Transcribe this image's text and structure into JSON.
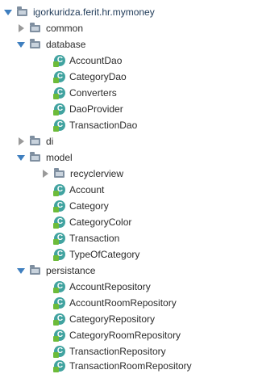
{
  "colors": {
    "expanded_arrow": "#3f7fbf",
    "collapsed_arrow": "#9a9a9a",
    "folder": "#7f8fa0",
    "class_icon": "#41a3a0",
    "class_badge": "#6dbb3a"
  },
  "tree": {
    "root": {
      "label": "igorkuridza.ferit.hr.mymoney",
      "expanded": true,
      "icon": "folder-icon"
    },
    "common": {
      "label": "common",
      "expanded": false,
      "icon": "folder-icon"
    },
    "database": {
      "label": "database",
      "expanded": true,
      "icon": "folder-icon",
      "items": [
        "AccountDao",
        "CategoryDao",
        "Converters",
        "DaoProvider",
        "TransactionDao"
      ]
    },
    "di": {
      "label": "di",
      "expanded": false,
      "icon": "folder-icon"
    },
    "model": {
      "label": "model",
      "expanded": true,
      "icon": "folder-icon",
      "recyclerview": {
        "label": "recyclerview",
        "expanded": false,
        "icon": "folder-icon"
      },
      "items": [
        "Account",
        "Category",
        "CategoryColor",
        "Transaction",
        "TypeOfCategory"
      ]
    },
    "persistance": {
      "label": "persistance",
      "expanded": true,
      "icon": "folder-icon",
      "items": [
        "AccountRepository",
        "AccountRoomRepository",
        "CategoryRepository",
        "CategoryRoomRepository",
        "TransactionRepository",
        "TransactionRoomRepository"
      ]
    },
    "class_icon_letter": "C"
  }
}
